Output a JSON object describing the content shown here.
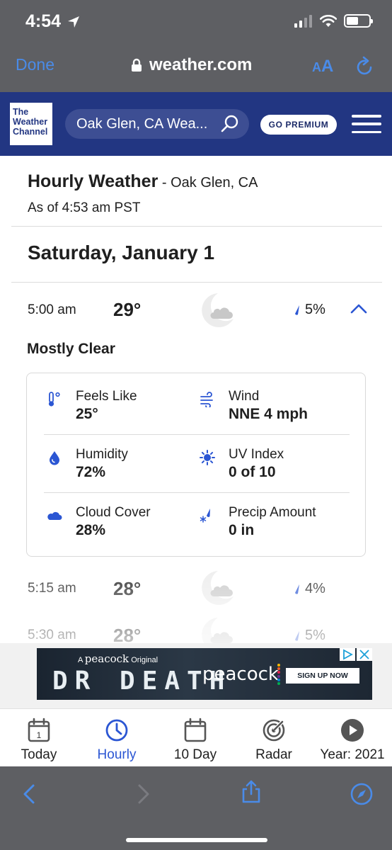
{
  "status_bar": {
    "time": "4:54"
  },
  "safari": {
    "done_label": "Done",
    "url": "weather.com",
    "aa_small": "A",
    "aa_large": "A"
  },
  "twc": {
    "logo_lines": [
      "The",
      "Weather",
      "Channel"
    ],
    "search_text": "Oak Glen, CA Wea...",
    "premium_label": "GO PREMIUM"
  },
  "page": {
    "title": "Hourly Weather",
    "title_location": " - Oak Glen, CA",
    "as_of": "As of 4:53 am PST",
    "day": "Saturday, January 1"
  },
  "hours": [
    {
      "time": "5:00 am",
      "temp": "29°",
      "precip": "5%",
      "condition": "Mostly Clear"
    },
    {
      "time": "5:15 am",
      "temp": "28°",
      "precip": "4%"
    },
    {
      "time": "5:30 am",
      "temp": "28°",
      "precip": "5%"
    }
  ],
  "details": [
    {
      "icon": "thermometer-icon",
      "label": "Feels Like",
      "value": "25°"
    },
    {
      "icon": "wind-icon",
      "label": "Wind",
      "value": "NNE 4 mph"
    },
    {
      "icon": "humidity-drop-icon",
      "label": "Humidity",
      "value": "72%"
    },
    {
      "icon": "uv-sun-icon",
      "label": "UV Index",
      "value": "0 of 10"
    },
    {
      "icon": "cloud-icon",
      "label": "Cloud Cover",
      "value": "28%"
    },
    {
      "icon": "precip-snow-icon",
      "label": "Precip Amount",
      "value": "0 in"
    }
  ],
  "ad": {
    "top_line_prefix": "A ",
    "top_line_brand": "peacock",
    "top_line_suffix": " Original",
    "title": "DR DEATH",
    "brand": "peacock",
    "cta": "SIGN UP NOW"
  },
  "nav": [
    {
      "label": "Today",
      "icon": "calendar-day-icon",
      "day_number": "1"
    },
    {
      "label": "Hourly",
      "icon": "clock-icon",
      "active": true
    },
    {
      "label": "10 Day",
      "icon": "calendar-icon"
    },
    {
      "label": "Radar",
      "icon": "radar-icon"
    },
    {
      "label": "Year: 2021",
      "icon": "play-icon"
    }
  ],
  "colors": {
    "twc_navy": "#223682",
    "accent_blue": "#2b56d3",
    "safari_blue": "#4a8be8",
    "peacock_dots": [
      "#f7b500",
      "#f35b2a",
      "#e4214e",
      "#6e2c8f",
      "#0088d2",
      "#00b04f"
    ]
  }
}
